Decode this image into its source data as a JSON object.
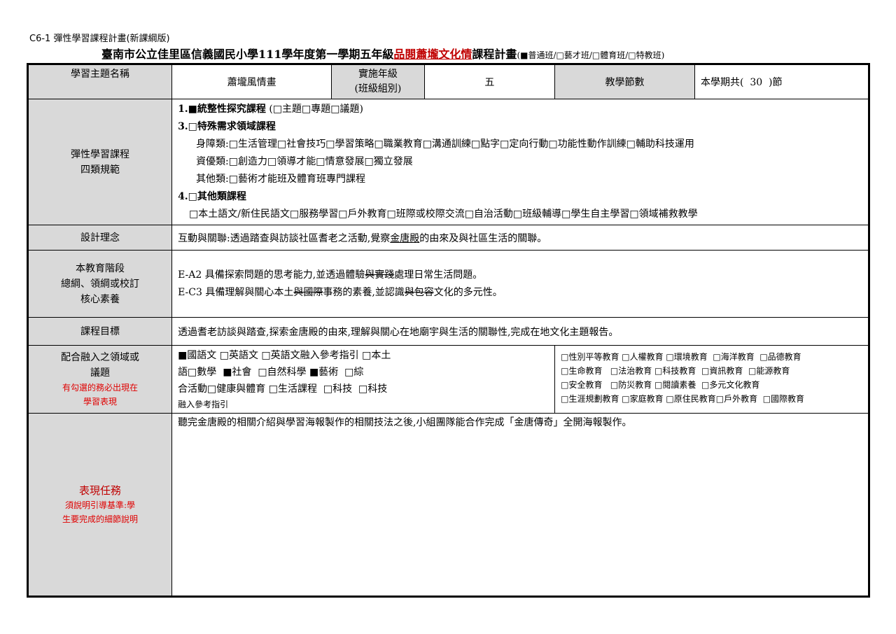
{
  "doc_code": "C6-1 彈性學習課程計畫(新課綱版)",
  "title": {
    "prefix": "臺南市公立佳里區信義國民小學111學年度第一學期五年級",
    "course": "品閱蕭壠文化情",
    "suffix": "課程計畫",
    "class_types": "(■普通班/□藝才班/□體育班/□特教班)"
  },
  "row1": {
    "theme_label": "學習主題名稱",
    "theme_value": "蕭壠風情畫",
    "grade_label": "實施年級\n(班級組別)",
    "grade_value": "五",
    "sessions_label": "教學節數",
    "sessions_value": "本學期共(  30  )節"
  },
  "flex": {
    "label": "彈性學習課程\n四類規範",
    "item1_title": "1.■統整性探究課程",
    "item1_opts": "(□主題□專題□議題)",
    "item3_title": "3.□特殊需求領域課程",
    "line_disability": "身障類:□生活管理□社會技巧□學習策略□職業教育□溝通訓練□點字□定向行動□功能性動作訓練□輔助科技運用",
    "line_gifted": "資優類:□創造力□領導才能□情意發展□獨立發展",
    "line_other": "其他類:□藝術才能班及體育班專門課程",
    "item4_title": "4.□其他類課程",
    "item4_opts": "□本土語文/新住民語文□服務學習□戶外教育□班際或校際交流□自治活動□班級輔導□學生自主學習□領域補救教學"
  },
  "design": {
    "label": "設計理念",
    "pre": "互動與關聯:透過踏查與訪談社區耆老之活動,覺察",
    "underline": "金唐殿",
    "post": "的由來及與社區生活的關聯。"
  },
  "core": {
    "label": "本教育階段\n總綱、領綱或校訂\n核心素養",
    "e_a2_a": "E-A2 具備探索問題的思考能力,並透過體驗",
    "e_a2_strike": "與實踐",
    "e_a2_b": "處理日常生活問題。",
    "e_c3_a": "E-C3 具備理解與關心本土",
    "e_c3_strike1": "與國際",
    "e_c3_b": "事務的素養,並認識",
    "e_c3_strike2": "與包容",
    "e_c3_c": "文化的多元性。"
  },
  "goal": {
    "label": "課程目標",
    "text": "透過耆老訪談與踏查,探索金唐殿的由來,理解與關心在地廟宇與生活的關聯性,完成在地文化主題報告。"
  },
  "integration": {
    "label": "配合融入之領域或\n議題",
    "note": "有勾選的務必出現在\n學習表現",
    "domains_l1": "■國語文 □英語文 □英語文融入參考指引 □本土",
    "domains_l2": "語□數學  ■社會  □自然科學 ■藝術  □綜",
    "domains_l3": "合活動□健康與體育 □生活課程  □科技  □科技",
    "domains_l4": "融入參考指引",
    "issues_l1": "□性別平等教育 □人權教育 □環境教育  □海洋教育  □品德教育",
    "issues_l2": "□生命教育   □法治教育 □科技教育  □資訊教育  □能源教育",
    "issues_l3": "□安全教育   □防災教育 □閱讀素養  □多元文化教育",
    "issues_l4": "□生涯規劃教育 □家庭教育 □原住民教育□戶外教育  □國際教育"
  },
  "task": {
    "label": "表現任務",
    "note": "須說明引導基準:學\n生要完成的細節說明",
    "text": "聽完金唐殿的相關介紹與學習海報製作的相關技法之後,小組團隊能合作完成「金唐傳奇」全開海報製作。"
  }
}
